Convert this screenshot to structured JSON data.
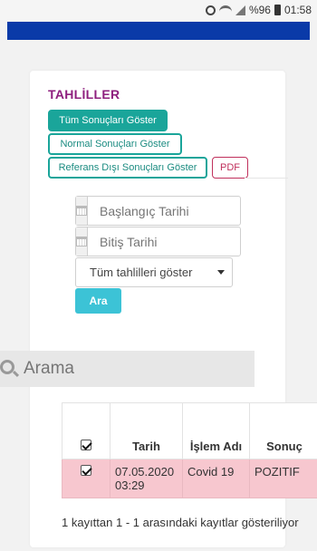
{
  "status_bar": {
    "battery_percent": "%96",
    "time": "01:58"
  },
  "colors": {
    "top_bar": "#0a3aa8",
    "accent": "#1aa59a",
    "title": "#8e1f7e",
    "pdf": "#c0305c",
    "search_button": "#3cc3d6",
    "row_highlight": "#f7c7cf"
  },
  "page": {
    "title": "TAHLİLLER"
  },
  "filters": {
    "all_label": "Tüm Sonuçları Göster",
    "normal_label": "Normal Sonuçları Göster",
    "out_of_range_label": "Referans Dışı Sonuçları Göster",
    "pdf_label": "PDF"
  },
  "form": {
    "start_date_placeholder": "Başlangıç Tarihi",
    "end_date_placeholder": "Bitiş Tarihi",
    "select_value": "Tüm tahlilleri göster",
    "submit_label": "Ara"
  },
  "search": {
    "placeholder": "Arama"
  },
  "table": {
    "headers": {
      "date": "Tarih",
      "name": "İşlem Adı",
      "result": "Sonuç"
    },
    "rows": [
      {
        "date": "07.05.2020 03:29",
        "name": "Covid 19",
        "result": "POZITIF",
        "checked": true
      }
    ]
  },
  "footer": {
    "info": "1 kayıttan 1 - 1 arasındaki kayıtlar gösteriliyor"
  },
  "icons": [
    "alarm-icon",
    "wifi-icon",
    "signal-icon",
    "battery-icon",
    "calendar-icon",
    "search-icon",
    "chevron-down-icon",
    "checkbox-icon"
  ]
}
